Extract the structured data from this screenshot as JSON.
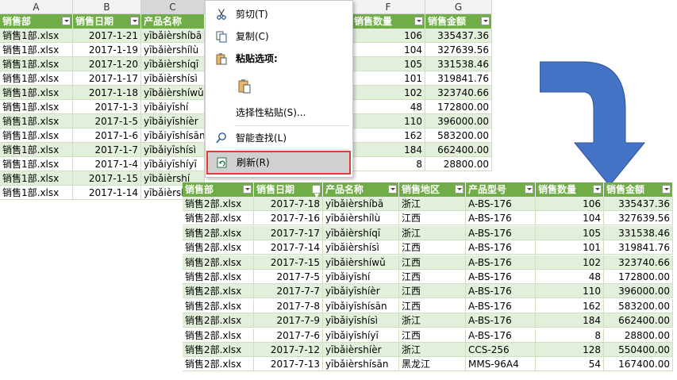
{
  "back_sheet": {
    "col_letters": [
      "A",
      "B",
      "C",
      "F",
      "G"
    ],
    "headers": [
      "销售部",
      "销售日期",
      "产品名称",
      "销售数量",
      "销售金额"
    ],
    "rows": [
      [
        "销售1部.xlsx",
        "2017-1-21",
        "yībǎièrshíbā",
        "106",
        "335437.36"
      ],
      [
        "销售1部.xlsx",
        "2017-1-19",
        "yībǎièrshílù",
        "104",
        "327639.56"
      ],
      [
        "销售1部.xlsx",
        "2017-1-20",
        "yībǎièrshíqī",
        "105",
        "331538.46"
      ],
      [
        "销售1部.xlsx",
        "2017-1-17",
        "yībǎièrshísì",
        "101",
        "319841.76"
      ],
      [
        "销售1部.xlsx",
        "2017-1-18",
        "yībǎièrshíwǔ",
        "102",
        "323740.66"
      ],
      [
        "销售1部.xlsx",
        "2017-1-3",
        "yībǎiyīshí",
        "48",
        "172800.00"
      ],
      [
        "销售1部.xlsx",
        "2017-1-5",
        "yībǎiyīshíèr",
        "110",
        "396000.00"
      ],
      [
        "销售1部.xlsx",
        "2017-1-6",
        "yībǎiyīshísān",
        "162",
        "583200.00"
      ],
      [
        "销售1部.xlsx",
        "2017-1-7",
        "yībǎiyīshísì",
        "184",
        "662400.00"
      ],
      [
        "销售1部.xlsx",
        "2017-1-4",
        "yībǎiyīshíyī",
        "8",
        "28800.00"
      ],
      [
        "销售1部.xlsx",
        "2017-1-15",
        "yībǎièrshí",
        "",
        ""
      ],
      [
        "销售1部.xlsx",
        "2017-1-14",
        "yībǎièrshí",
        "",
        ""
      ]
    ]
  },
  "context_menu": {
    "items": [
      {
        "label": "剪切(T)",
        "icon": "scissors-icon"
      },
      {
        "label": "复制(C)",
        "icon": "copy-icon"
      },
      {
        "label": "粘贴选项:",
        "icon": "paste-icon"
      },
      {
        "label": "",
        "icon": "paste-option-icon"
      },
      {
        "label": "选择性粘贴(S)...",
        "icon": ""
      },
      {
        "label": "智能查找(L)",
        "icon": "smart-lookup-icon"
      },
      {
        "label": "刷新(R)",
        "icon": "refresh-icon"
      }
    ]
  },
  "front_sheet": {
    "headers": [
      "销售部",
      "销售日期",
      "产品名称",
      "销售地区",
      "产品型号",
      "销售数量",
      "销售金额"
    ],
    "rows": [
      [
        "销售2部.xlsx",
        "2017-7-18",
        "yībǎièrshíbā",
        "浙江",
        "A-BS-176",
        "106",
        "335437.36"
      ],
      [
        "销售2部.xlsx",
        "2017-7-16",
        "yībǎièrshílù",
        "江西",
        "A-BS-176",
        "104",
        "327639.56"
      ],
      [
        "销售2部.xlsx",
        "2017-7-17",
        "yībǎièrshíqī",
        "浙江",
        "A-BS-176",
        "105",
        "331538.46"
      ],
      [
        "销售2部.xlsx",
        "2017-7-14",
        "yībǎièrshísì",
        "江西",
        "A-BS-176",
        "101",
        "319841.76"
      ],
      [
        "销售2部.xlsx",
        "2017-7-15",
        "yībǎièrshíwǔ",
        "江西",
        "A-BS-176",
        "102",
        "323740.66"
      ],
      [
        "销售2部.xlsx",
        "2017-7-5",
        "yībǎiyīshí",
        "江西",
        "A-BS-176",
        "48",
        "172800.00"
      ],
      [
        "销售2部.xlsx",
        "2017-7-7",
        "yībǎiyīshíèr",
        "江西",
        "A-BS-176",
        "110",
        "396000.00"
      ],
      [
        "销售2部.xlsx",
        "2017-7-8",
        "yībǎiyīshísān",
        "江西",
        "A-BS-176",
        "162",
        "583200.00"
      ],
      [
        "销售2部.xlsx",
        "2017-7-9",
        "yībǎiyīshísì",
        "浙江",
        "A-BS-176",
        "184",
        "662400.00"
      ],
      [
        "销售2部.xlsx",
        "2017-7-6",
        "yībǎiyīshíyī",
        "江西",
        "A-BS-176",
        "8",
        "28800.00"
      ],
      [
        "销售2部.xlsx",
        "2017-7-12",
        "yībǎièrshíèr",
        "浙江",
        "CCS-256",
        "128",
        "550400.00"
      ],
      [
        "销售2部.xlsx",
        "2017-7-13",
        "yībǎièrshísān",
        "黑龙江",
        "MMS-96A4",
        "54",
        "167400.00"
      ]
    ]
  },
  "colors": {
    "header_green": "#70ad47",
    "band_green": "#e2efda",
    "arrow_blue": "#4472c4",
    "highlight_red": "#e53935"
  }
}
